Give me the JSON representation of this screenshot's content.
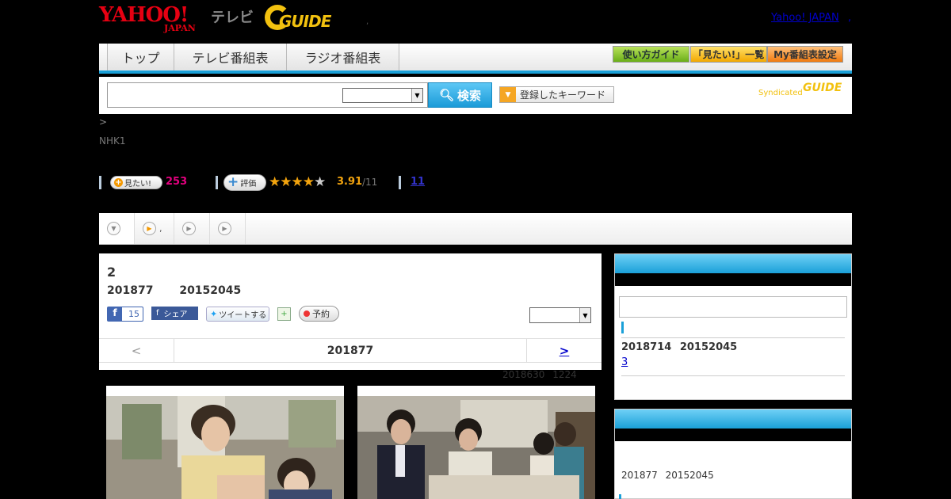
{
  "header": {
    "logo_yahoo": "YAHOO!",
    "logo_japan": "JAPAN",
    "logo_tv": "テレビ",
    "logo_gguide": "GUIDE",
    "logo_dot": ",",
    "yahoo_japan_link": "Yahoo! JAPAN",
    "yahoo_japan_dot": ","
  },
  "nav": {
    "tabs": [
      {
        "label": "トップ"
      },
      {
        "label": "テレビ番組表"
      },
      {
        "label": "ラジオ番組表"
      }
    ],
    "guide_buttons": [
      {
        "label": "使い方ガイド"
      },
      {
        "label": "「見たい!」一覧"
      },
      {
        "label": "My番組表設定"
      }
    ]
  },
  "search": {
    "input_value": "",
    "select_value": "",
    "button_label": "検索",
    "keyword_button": "登録したキーワード",
    "syndicated_label": "Syndicated",
    "syndicated_logo": "GUIDE"
  },
  "breadcrumb": ">",
  "channel": "NHK1",
  "stats": {
    "mitai_label": "見たい!",
    "mitai_count": "253",
    "hyoka_label": "評価",
    "rating": "3.91",
    "rating_count": "/11",
    "review_link": "11"
  },
  "tabs_strip": {
    "tab2_label": ","
  },
  "program": {
    "title": "2",
    "date_line": "201877 20152045",
    "fb_like_count": "15",
    "fb_share_label": "シェア",
    "tweet_label": "ツイートする",
    "reserve_label": "予約",
    "select_value": "",
    "nav_prev": "<",
    "nav_date": "201877",
    "nav_next": ">",
    "updated": "2018630 1224"
  },
  "sidebar": {
    "box1_date": "2018714 20152045",
    "box1_link": "3",
    "box2_date": "201877 20152045"
  },
  "colors": {
    "accent_blue": "#1aa0d8",
    "yahoo_red": "#e60012",
    "gguide_yellow": "#f2c10f",
    "mitai_pink": "#e4007f",
    "star_orange": "#f3a40e"
  }
}
